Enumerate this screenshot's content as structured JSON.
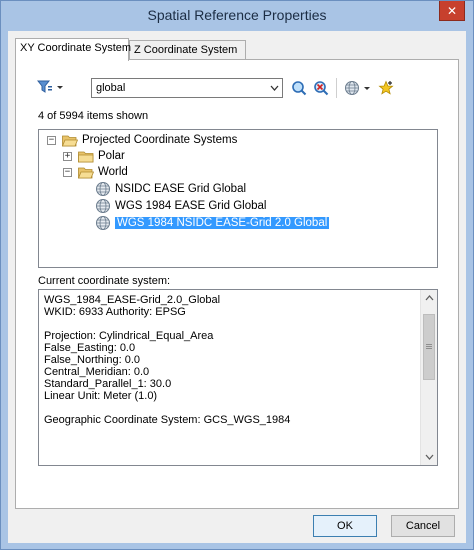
{
  "window": {
    "title": "Spatial Reference Properties",
    "close_glyph": "✕"
  },
  "tabs": [
    {
      "label": "XY Coordinate System",
      "active": true
    },
    {
      "label": "Z Coordinate System",
      "active": false
    }
  ],
  "toolbar": {
    "search_value": "global",
    "filter_icon": "filter-icon",
    "search_icon": "magnifier-icon",
    "clear_icon": "clear-search-icon",
    "globe_icon": "globe-icon",
    "favorite_icon": "add-favorite-icon"
  },
  "count_text": "4 of 5994 items shown",
  "tree": {
    "root": {
      "label": "Projected Coordinate Systems",
      "expander": "−"
    },
    "polar": {
      "label": "Polar",
      "expander": "+"
    },
    "world": {
      "label": "World",
      "expander": "−"
    },
    "items": [
      {
        "label": "NSIDC EASE Grid Global"
      },
      {
        "label": "WGS 1984 EASE Grid Global"
      },
      {
        "label": "WGS 1984 NSIDC EASE-Grid 2.0 Global",
        "selected": true
      }
    ]
  },
  "current": {
    "label": "Current coordinate system:",
    "lines": [
      "WGS_1984_EASE-Grid_2.0_Global",
      "WKID: 6933 Authority: EPSG",
      "",
      "Projection: Cylindrical_Equal_Area",
      "False_Easting: 0.0",
      "False_Northing: 0.0",
      "Central_Meridian: 0.0",
      "Standard_Parallel_1: 30.0",
      "Linear Unit: Meter (1.0)",
      "",
      "Geographic Coordinate System: GCS_WGS_1984"
    ]
  },
  "buttons": {
    "ok": "OK",
    "cancel": "Cancel"
  },
  "colors": {
    "selection": "#3399ff",
    "title_bar": "#a9c4e5",
    "close": "#c7402d",
    "folder": "#e8c36a"
  }
}
